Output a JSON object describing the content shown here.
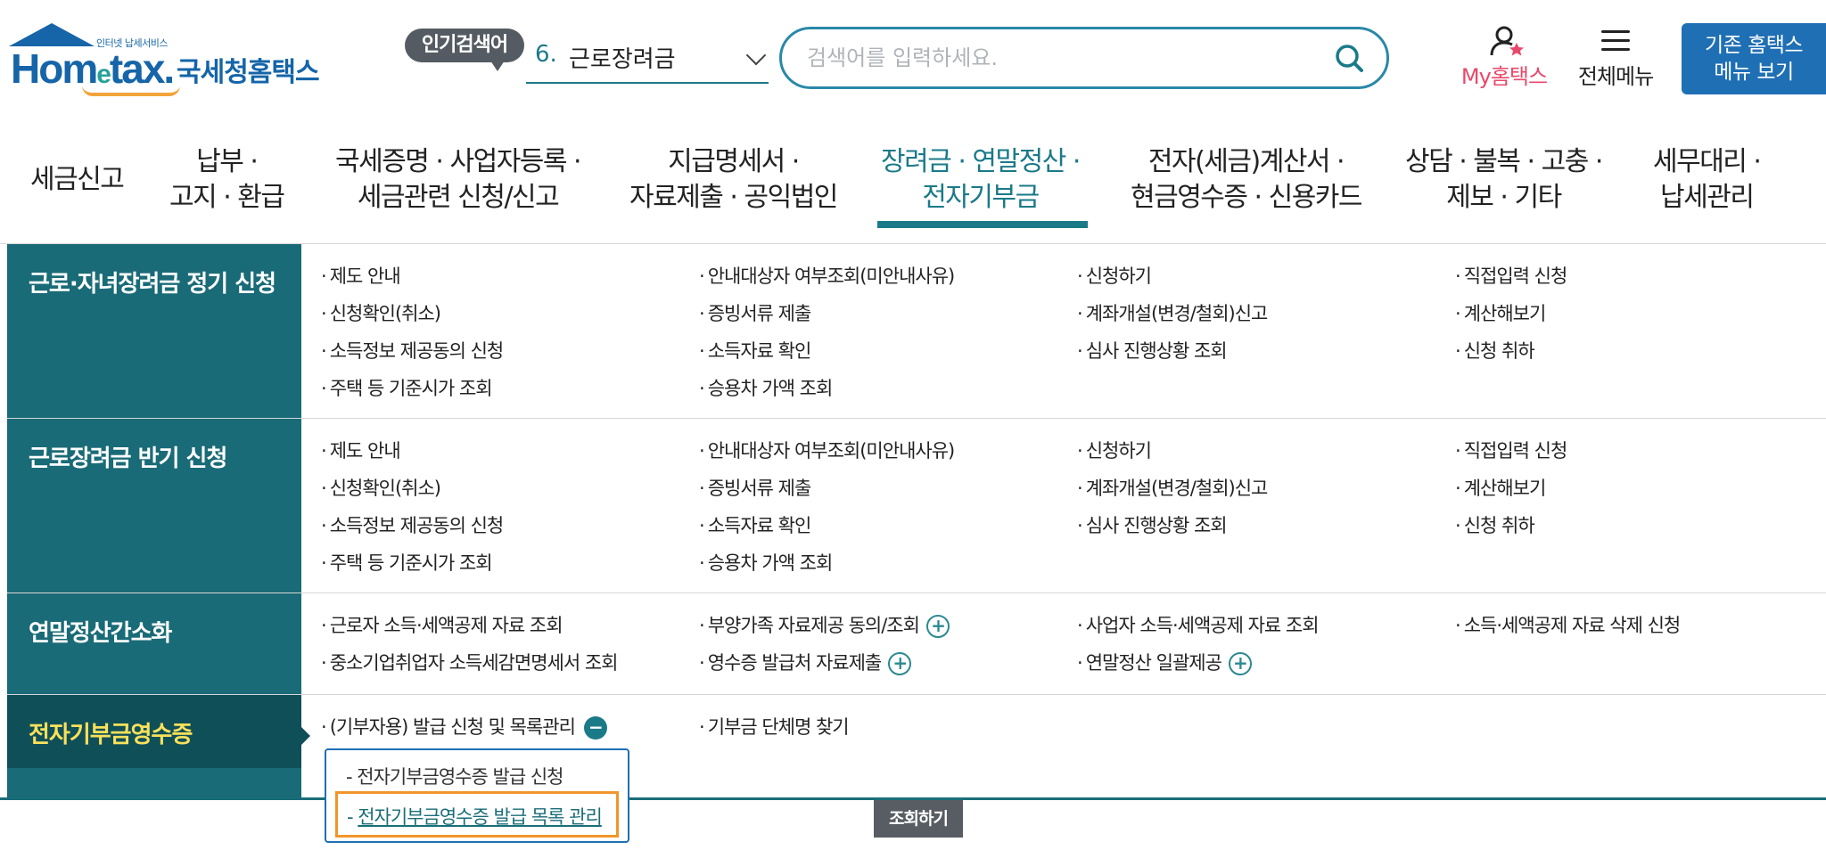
{
  "header": {
    "logo_tag": "인터넷 납세서비스",
    "logo_brand_a": "Hom",
    "logo_brand_e": "e",
    "logo_brand_b": "tax.",
    "logo_korean": "국세청홈택스",
    "popular_badge": "인기검색어",
    "popular_rank": "6.",
    "popular_keyword": "근로장려금",
    "search_placeholder": "검색어를 입력하세요.",
    "my_hometax": "My홈택스",
    "all_menu": "전체메뉴",
    "old_home_line1": "기존 홈택스",
    "old_home_line2": "메뉴 보기"
  },
  "gnb": [
    {
      "line1": "세금신고",
      "line2": ""
    },
    {
      "line1": "납부 ·",
      "line2": "고지 · 환급"
    },
    {
      "line1": "국세증명 · 사업자등록 ·",
      "line2": "세금관련 신청/신고"
    },
    {
      "line1": "지급명세서 ·",
      "line2": "자료제출 · 공익법인"
    },
    {
      "line1": "장려금 · 연말정산 ·",
      "line2": "전자기부금"
    },
    {
      "line1": "전자(세금)계산서 ·",
      "line2": "현금영수증 · 신용카드"
    },
    {
      "line1": "상담 · 불복 · 고충 ·",
      "line2": "제보 · 기타"
    },
    {
      "line1": "세무대리 ·",
      "line2": "납세관리"
    }
  ],
  "sections": [
    {
      "title": "근로·자녀장려금 정기 신청",
      "links": [
        [
          "제도 안내",
          "안내대상자 여부조회(미안내사유)",
          "신청하기",
          "직접입력 신청"
        ],
        [
          "신청확인(취소)",
          "증빙서류 제출",
          "계좌개설(변경/철회)신고",
          "계산해보기"
        ],
        [
          "소득정보 제공동의 신청",
          "소득자료 확인",
          "심사 진행상황 조회",
          "신청 취하"
        ],
        [
          "주택 등 기준시가 조회",
          "승용차 가액 조회"
        ]
      ]
    },
    {
      "title": "근로장려금 반기 신청",
      "links": [
        [
          "제도 안내",
          "안내대상자 여부조회(미안내사유)",
          "신청하기",
          "직접입력 신청"
        ],
        [
          "신청확인(취소)",
          "증빙서류 제출",
          "계좌개설(변경/철회)신고",
          "계산해보기"
        ],
        [
          "소득정보 제공동의 신청",
          "소득자료 확인",
          "심사 진행상황 조회",
          "신청 취하"
        ],
        [
          "주택 등 기준시가 조회",
          "승용차 가액 조회"
        ]
      ]
    },
    {
      "title": "연말정산간소화",
      "links": [
        [
          "근로자 소득·세액공제 자료 조회",
          "부양가족 자료제공 동의/조회",
          "사업자 소득·세액공제 자료 조회",
          "소득·세액공제 자료 삭제 신청"
        ],
        [
          "중소기업취업자 소득세감면명세서 조회",
          "영수증 발급처 자료제출",
          "연말정산 일괄제공"
        ]
      ]
    },
    {
      "title": "전자기부금영수증",
      "links": [
        [
          "(기부자용) 발급 신청 및 목록관리",
          "기부금 단체명 찾기"
        ]
      ],
      "submenu": [
        "전자기부금영수증 발급 신청",
        "전자기부금영수증 발급 목록 관리"
      ]
    }
  ],
  "query_button": "조회하기"
}
